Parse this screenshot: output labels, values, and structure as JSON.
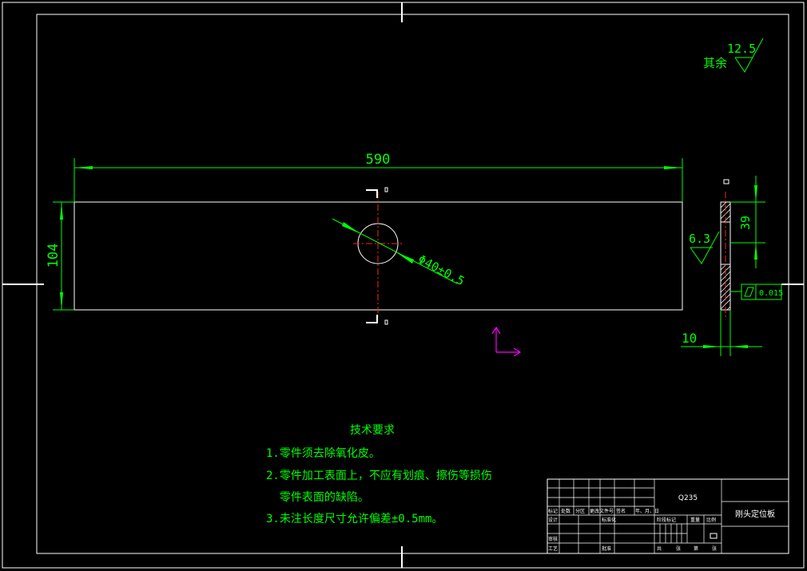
{
  "surface_finish_other": {
    "prefix": "其余",
    "value": "12.5"
  },
  "dimensions": {
    "length": "590",
    "height": "104",
    "hole": "Φ40±0.5",
    "side_height": "39",
    "side_roughness": "6.3",
    "thickness": "10",
    "flatness": "0.015"
  },
  "notes": {
    "title": "技术要求",
    "lines": [
      "1.零件须去除氧化皮。",
      "2.零件加工表面上，不应有划痕、擦伤等损伤",
      "  零件表面的缺陷。",
      "3.未注长度尺寸允许偏差±0.5mm。"
    ]
  },
  "title_block": {
    "material": "Q235",
    "part_name": "刚头定位板",
    "row_labels": [
      "标记",
      "处数",
      "分区",
      "更改文件号",
      "签名",
      "年、月、日"
    ],
    "left_labels": [
      "设计",
      "审核",
      "工艺"
    ],
    "mid_labels": [
      "标准化",
      "批准"
    ],
    "stage_labels": [
      "阶段标记",
      "重量",
      "比例"
    ],
    "sheet_labels": [
      "共",
      "张",
      "第",
      "张"
    ]
  },
  "colors": {
    "lines": "#ffffff",
    "dims": "#00ff00",
    "center": "#ff2020",
    "ucs": "#ff00ff"
  }
}
